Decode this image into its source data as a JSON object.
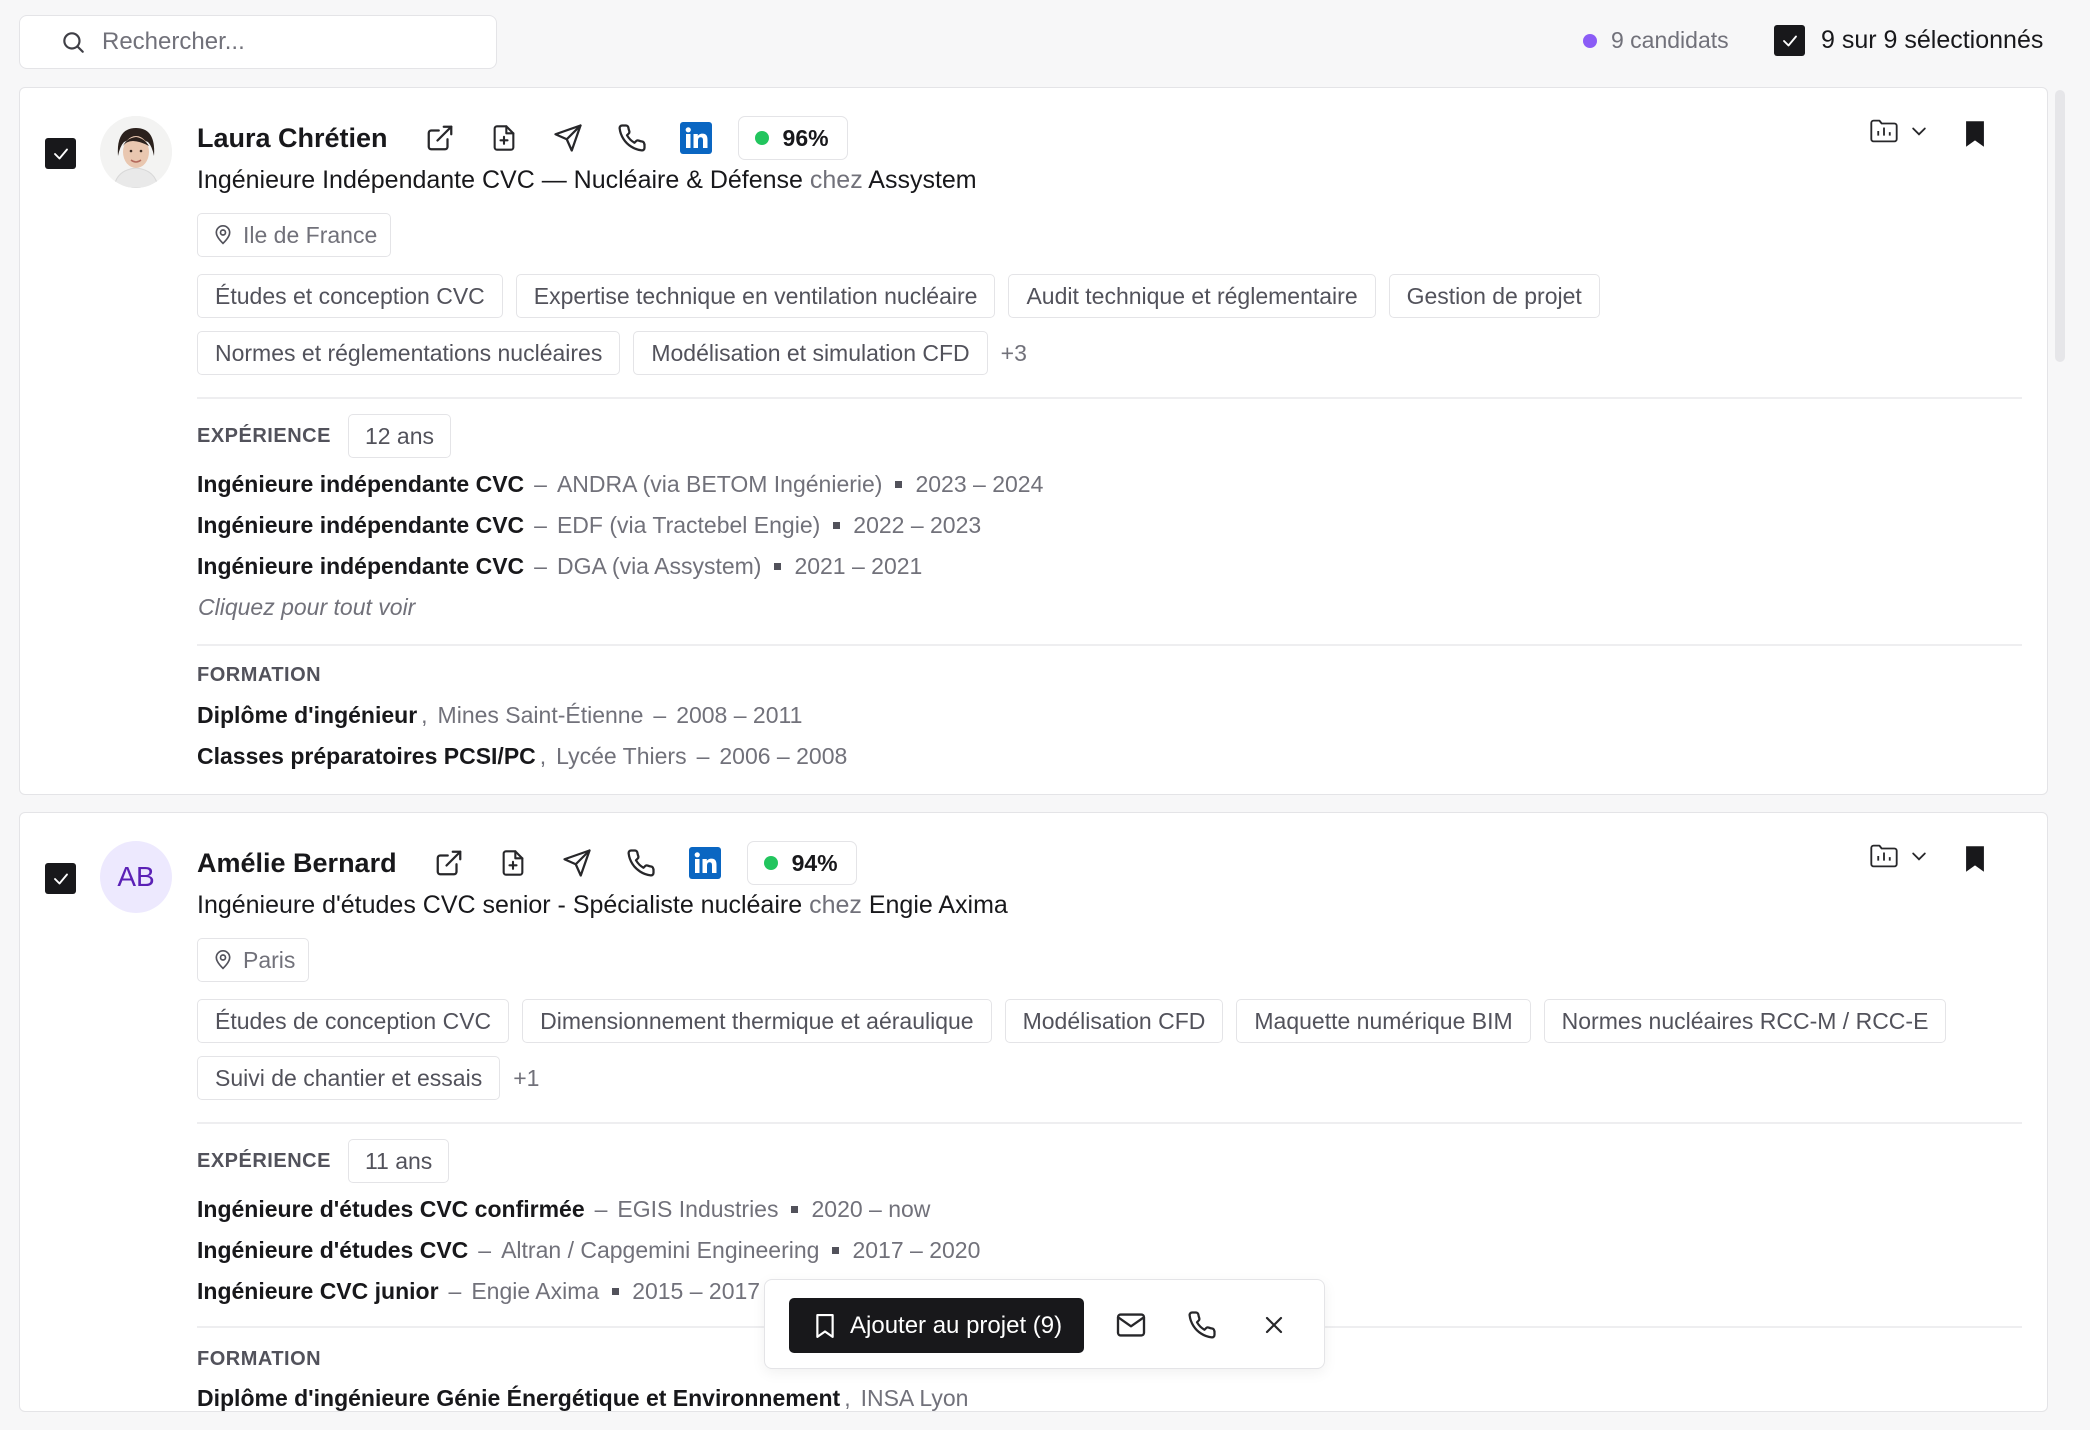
{
  "search": {
    "placeholder": "Rechercher..."
  },
  "summary": {
    "candidates": "9 candidats",
    "selected": "9 sur 9 sélectionnés"
  },
  "candidates": [
    {
      "name": "Laura Chrétien",
      "avatar_initials": "",
      "score": "96%",
      "title": "Ingénieure Indépendante CVC — Nucléaire & Défense",
      "at": "chez",
      "company": "Assystem",
      "location": "Ile de France",
      "skills": [
        "Études et conception CVC",
        "Expertise technique en ventilation nucléaire",
        "Audit technique et réglementaire",
        "Gestion de projet",
        "Normes et réglementations nucléaires",
        "Modélisation et simulation CFD"
      ],
      "more_skills": "+3",
      "experience_label": "EXPÉRIENCE",
      "experience_years": "12 ans",
      "experience": [
        {
          "role": "Ingénieure indépendante CVC",
          "company": "ANDRA (via BETOM Ingénierie)",
          "period": "2023 – 2024"
        },
        {
          "role": "Ingénieure indépendante CVC",
          "company": "EDF (via Tractebel Engie)",
          "period": "2022 – 2023"
        },
        {
          "role": "Ingénieure indépendante CVC",
          "company": "DGA (via Assystem)",
          "period": "2021 – 2021"
        }
      ],
      "see_all": "Cliquez pour tout voir",
      "education_label": "FORMATION",
      "education": [
        {
          "degree": "Diplôme d'ingénieur",
          "school": "Mines Saint-Étienne",
          "period": "2008 – 2011"
        },
        {
          "degree": "Classes préparatoires PCSI/PC",
          "school": "Lycée Thiers",
          "period": "2006 – 2008"
        }
      ]
    },
    {
      "name": "Amélie Bernard",
      "avatar_initials": "AB",
      "score": "94%",
      "title": "Ingénieure d'études CVC senior - Spécialiste nucléaire",
      "at": "chez",
      "company": "Engie Axima",
      "location": "Paris",
      "skills": [
        "Études de conception CVC",
        "Dimensionnement thermique et aéraulique",
        "Modélisation CFD",
        "Maquette numérique BIM",
        "Normes nucléaires RCC-M / RCC-E",
        "Suivi de chantier et essais"
      ],
      "more_skills": "+1",
      "experience_label": "EXPÉRIENCE",
      "experience_years": "11 ans",
      "experience": [
        {
          "role": "Ingénieure d'études CVC confirmée",
          "company": "EGIS Industries",
          "period": "2020 – now"
        },
        {
          "role": "Ingénieure d'études CVC",
          "company": "Altran / Capgemini Engineering",
          "period": "2017 – 2020"
        },
        {
          "role": "Ingénieure CVC junior",
          "company": "Engie Axima",
          "period": "2015 – 2017"
        }
      ],
      "education_label": "FORMATION",
      "education": [
        {
          "degree": "Diplôme d'ingénieure Génie Énergétique et Environnement",
          "school": "INSA Lyon",
          "period": ""
        }
      ]
    }
  ],
  "action_bar": {
    "add_label": "Ajouter au projet (9)"
  },
  "colors": {
    "accent_purple": "#8b5cf6",
    "score_green": "#22c55e",
    "linkedin_blue": "#0a66c2",
    "dark": "#18181b"
  },
  "icons": [
    "search-icon",
    "check-icon",
    "external-link-icon",
    "file-plus-icon",
    "send-icon",
    "phone-icon",
    "linkedin-icon",
    "folder-chart-icon",
    "chevron-down-icon",
    "bookmark-icon",
    "map-pin-icon",
    "mail-icon",
    "close-icon"
  ]
}
